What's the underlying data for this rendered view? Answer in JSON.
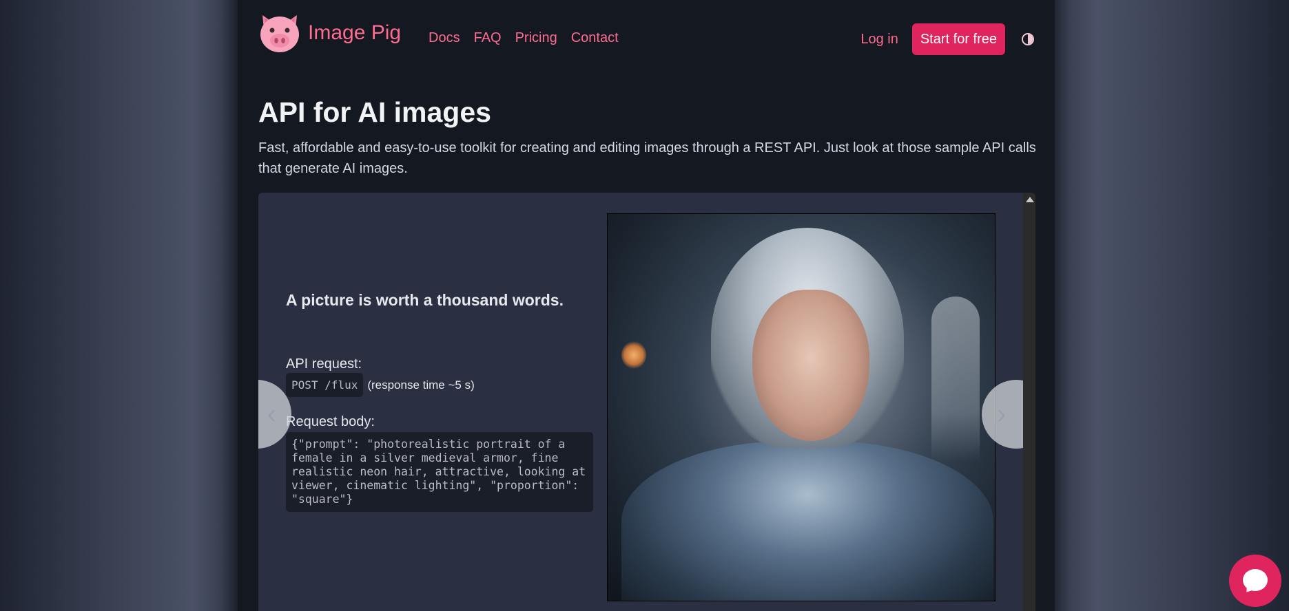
{
  "header": {
    "brand": "Image Pig",
    "nav": [
      "Docs",
      "FAQ",
      "Pricing",
      "Contact"
    ],
    "login": "Log in",
    "cta": "Start for free"
  },
  "hero": {
    "title": "API for AI images",
    "lead": "Fast, affordable and easy-to-use toolkit for creating and editing images through a REST API. Just look at those sample API calls that generate AI images."
  },
  "demo": {
    "tagline": "A picture is worth a thousand words.",
    "request_label": "API request:",
    "endpoint": "POST /flux",
    "response_time": "(response time ~5 s)",
    "body_label": "Request body:",
    "body": "{\"prompt\": \"photorealistic portrait of a female in a silver medieval armor, fine realistic neon hair, attractive, looking at viewer, cinematic lighting\", \"proportion\": \"square\"}",
    "prev": "‹",
    "next": "›"
  },
  "colors": {
    "accent": "#e0245e",
    "link": "#ff6b8f",
    "panel": "#2a3042",
    "page": "#141821"
  }
}
